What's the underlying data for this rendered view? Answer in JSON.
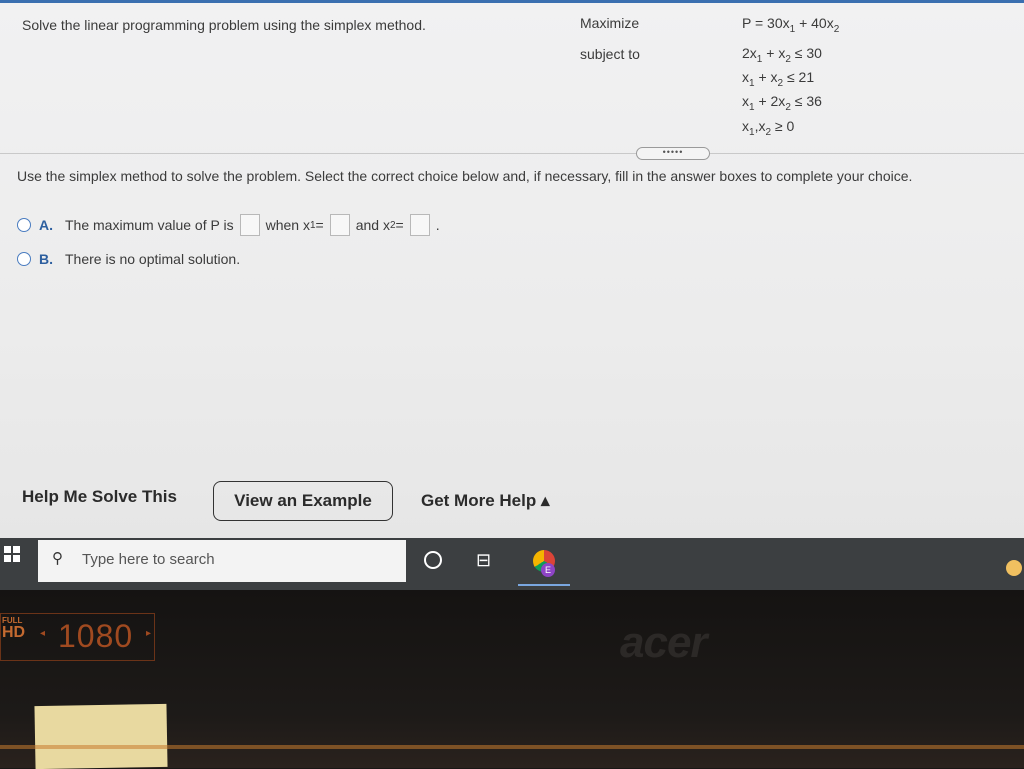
{
  "problem": {
    "intro": "Solve the linear programming problem using the simplex method.",
    "maximize_label": "Maximize",
    "subject_to_label": "subject to",
    "objective": [
      "P = 30x",
      "1",
      " + 40x",
      "2"
    ],
    "constraint1": [
      "2x",
      "1",
      " + x",
      "2",
      " ≤ 30"
    ],
    "constraint2": [
      "x",
      "1",
      " + x",
      "2",
      " ≤ 21"
    ],
    "constraint3": [
      "x",
      "1",
      " + 2x",
      "2",
      " ≤ 36"
    ],
    "nonneg": [
      "x",
      "1",
      ",x",
      "2",
      " ≥ 0"
    ],
    "expander_dots": "•••••"
  },
  "instruction": "Use the simplex method to solve the problem. Select the correct choice below and, if necessary, fill in the answer boxes to complete your choice.",
  "choices": {
    "a": {
      "letter": "A.",
      "part1": "The maximum value of P is",
      "part2": "when x",
      "sub1": "1",
      "eq1": " =",
      "part3": "and x",
      "sub2": "2",
      "eq2": " =",
      "end": "."
    },
    "b": {
      "letter": "B.",
      "text": "There is no optimal solution."
    }
  },
  "buttons": {
    "help_me_solve": "Help Me Solve This",
    "view_example": "View an Example",
    "get_more_help": "Get More Help ▴"
  },
  "taskbar": {
    "search_placeholder": "Type here to search",
    "search_icon": "magnifier-icon",
    "chrome_badge": "E"
  },
  "bezel": {
    "hd_full": "FULL",
    "hd_hd": "HD",
    "resolution": "1080",
    "brand": "acer"
  }
}
